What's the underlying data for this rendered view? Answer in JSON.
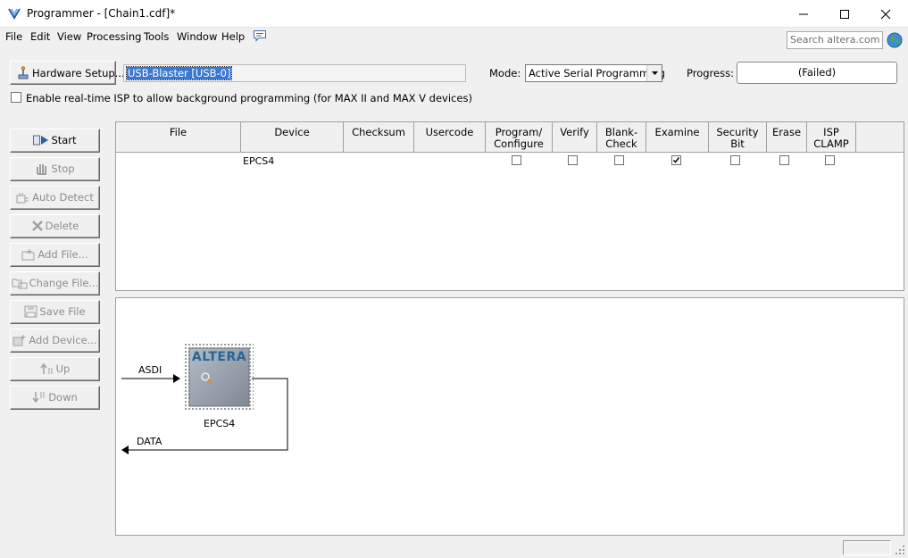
{
  "window": {
    "title": "Programmer - [Chain1.cdf]*",
    "icon": "programmer-app-icon"
  },
  "menu": {
    "items": [
      "File",
      "Edit",
      "View",
      "Processing",
      "Tools",
      "Window",
      "Help"
    ],
    "help_icon": "speech-bubble-icon"
  },
  "search": {
    "placeholder": "Search altera.com",
    "icon": "globe-icon"
  },
  "toolbar": {
    "hardware_setup_label": "Hardware Setup...",
    "hardware_value": "USB-Blaster [USB-0]",
    "mode_label": "Mode:",
    "mode_value": "Active Serial Programming",
    "progress_label": "Progress:",
    "progress_value": "(Failed)",
    "isp_checkbox_label": "Enable real-time ISP to allow background programming (for MAX II and MAX V devices)",
    "isp_checked": false
  },
  "sidebar": {
    "buttons": [
      {
        "label": "Start",
        "icon": "play-arrow-icon",
        "enabled": true
      },
      {
        "label": "Stop",
        "icon": "stop-hand-icon",
        "enabled": false
      },
      {
        "label": "Auto Detect",
        "icon": "auto-detect-icon",
        "enabled": false
      },
      {
        "label": "Delete",
        "icon": "delete-x-icon",
        "enabled": false
      },
      {
        "label": "Add File...",
        "icon": "add-file-icon",
        "enabled": false
      },
      {
        "label": "Change File...",
        "icon": "change-file-icon",
        "enabled": false
      },
      {
        "label": "Save File",
        "icon": "save-disk-icon",
        "enabled": false
      },
      {
        "label": "Add Device...",
        "icon": "add-device-icon",
        "enabled": false
      },
      {
        "label": "Up",
        "icon": "up-arrow-icon",
        "enabled": false
      },
      {
        "label": "Down",
        "icon": "down-arrow-icon",
        "enabled": false
      }
    ]
  },
  "table": {
    "columns": [
      "File",
      "Device",
      "Checksum",
      "Usercode",
      "Program/\nConfigure",
      "Verify",
      "Blank-\nCheck",
      "Examine",
      "Security\nBit",
      "Erase",
      "ISP\nCLAMP"
    ],
    "rows": [
      {
        "file": "",
        "device": "EPCS4",
        "checksum": "",
        "usercode": "",
        "program_configure": false,
        "verify": false,
        "blank_check": false,
        "examine": true,
        "security_bit": false,
        "erase": false,
        "isp_clamp": false
      }
    ]
  },
  "chain": {
    "input_label": "ASDI",
    "output_label": "DATA",
    "chip_logo": "ALTERA",
    "chip_name": "EPCS4",
    "chip_icon": "altera-chip-icon"
  },
  "colors": {
    "selection": "#3a77d1",
    "chip_logo": "#2a6496",
    "disabled_text": "#8d8d8d"
  }
}
